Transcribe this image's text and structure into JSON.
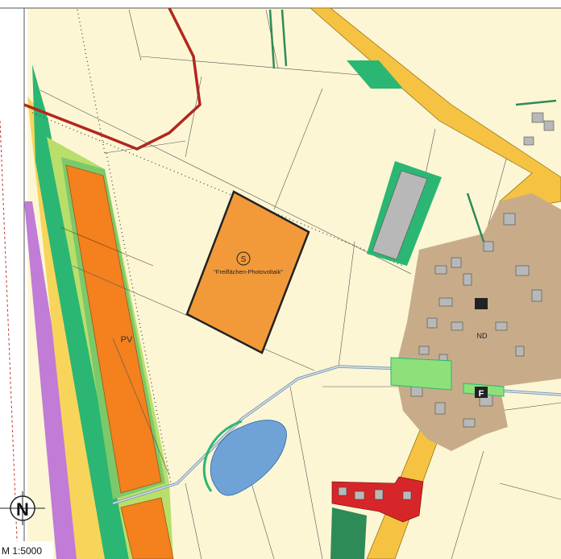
{
  "zones": {
    "pv_north_label": "\"Freiflächen-Photovoltaik\"",
    "pv_north_symbol": "S",
    "pv_west_label": "PV"
  },
  "village_markers": {
    "fire_station": "F",
    "natural_monument": "ND"
  },
  "north_arrow": {
    "letter": "N"
  },
  "scale": {
    "text": "M 1:5000"
  },
  "colors": {
    "farmland": "#fcf6d4",
    "pv_area": "#f29a3a",
    "pv_west": "#f4801e",
    "main_road": "#f5c242",
    "village": "#c8ac8a",
    "buildings": "#b8b8b8",
    "residential_red": "#d7262a",
    "water": "#6fa3d8",
    "green_strip": "#2bb673",
    "boundary_red": "#b3261e"
  }
}
